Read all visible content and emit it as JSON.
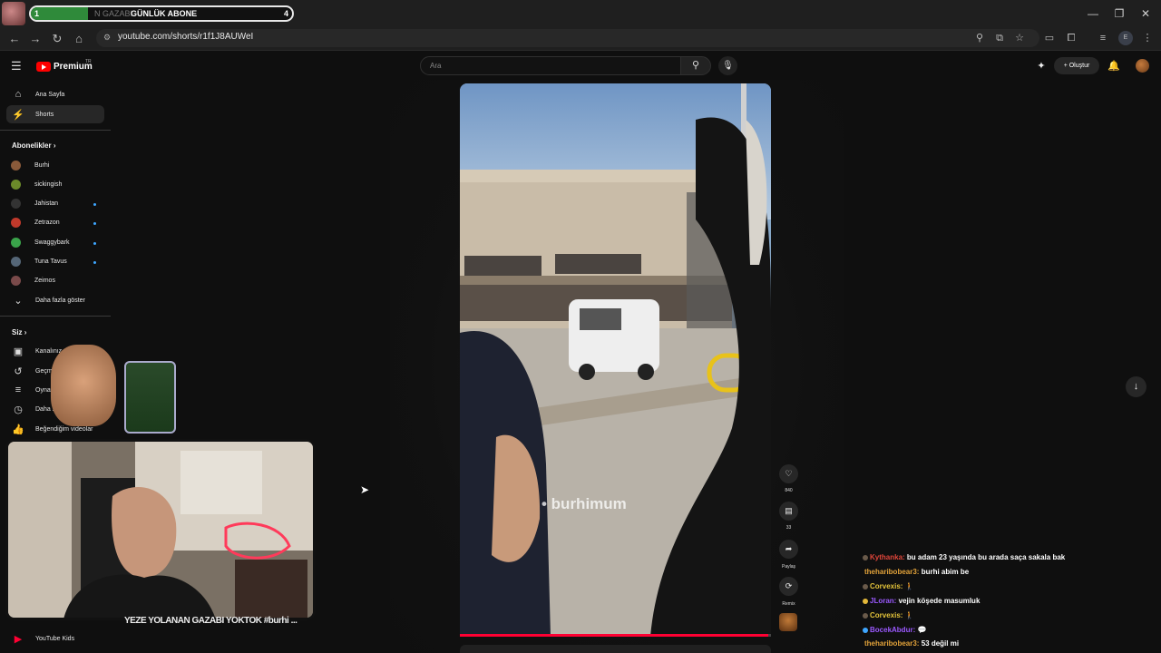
{
  "overlay": {
    "goal_label": "GÜNLÜK ABONE",
    "goal_bg_text": "N GAZABI",
    "goal_start": "1",
    "goal_end": "4",
    "goal_progress": 0.22,
    "stream_title": "YEZE YOLANAN GAZABI YOKTOK #burhi ..."
  },
  "browser": {
    "url": "youtube.com/shorts/r1f1J8AUWeI"
  },
  "header": {
    "logo_text": "Premium",
    "country": "TR",
    "search_placeholder": "Ara",
    "create_label": "Oluştur"
  },
  "sidebar": {
    "main": [
      {
        "label": "Ana Sayfa",
        "icon": "home-icon"
      },
      {
        "label": "Shorts",
        "icon": "shorts-icon"
      }
    ],
    "subscriptions_heading": "Abonelikler",
    "subscriptions": [
      {
        "label": "Burhi",
        "color": "#8a5a3a",
        "live": false
      },
      {
        "label": "sickingish",
        "color": "#6b8a2a",
        "live": false
      },
      {
        "label": "Jahistan",
        "color": "#333333",
        "live": true
      },
      {
        "label": "Zetrazon",
        "color": "#c0392b",
        "live": true
      },
      {
        "label": "Swaggybark",
        "color": "#3aa34a",
        "live": true
      },
      {
        "label": "Tuna Tavus",
        "color": "#556677",
        "live": true
      },
      {
        "label": "Zeimos",
        "color": "#7a4a4a",
        "live": false
      }
    ],
    "show_more_label": "Daha fazla göster",
    "you_heading": "Siz",
    "you_items": [
      {
        "label": "Kanalınız",
        "icon": "channel-icon"
      },
      {
        "label": "Geçmiş",
        "icon": "history-icon"
      },
      {
        "label": "Oynatma listeleri",
        "icon": "playlist-icon"
      },
      {
        "label": "Daha sonra izle",
        "icon": "clock-icon"
      },
      {
        "label": "Beğendiğim videolar",
        "icon": "thumbs-up-icon"
      }
    ],
    "kids_label": "YouTube Kids"
  },
  "short": {
    "watermark": "• burhimum",
    "likes": "840",
    "comments": "33",
    "share_label": "Paylaş",
    "remix_label": "Remix",
    "progress": 0.99
  },
  "chat": [
    {
      "user": "Kythanka:",
      "color": "#e0453a",
      "msg": "bu adam 23 yaşında bu arada saça sakala bak"
    },
    {
      "user": "theharibobear3:",
      "color": "#e3a33a",
      "msg": "burhi abim be"
    },
    {
      "user": "Corvexis:",
      "color": "#e3c33a",
      "msg": "🚶"
    },
    {
      "user": "JLoran:",
      "color": "#9b59ff",
      "msg": "vejin köşede masumluk"
    },
    {
      "user": "Corvexis:",
      "color": "#e3c33a",
      "msg": "🚶"
    },
    {
      "user": "BocekAbdur:",
      "color": "#9b59ff",
      "msg": "💬"
    },
    {
      "user": "theharibobear3:",
      "color": "#e3a33a",
      "msg": "53 değil mi"
    }
  ]
}
